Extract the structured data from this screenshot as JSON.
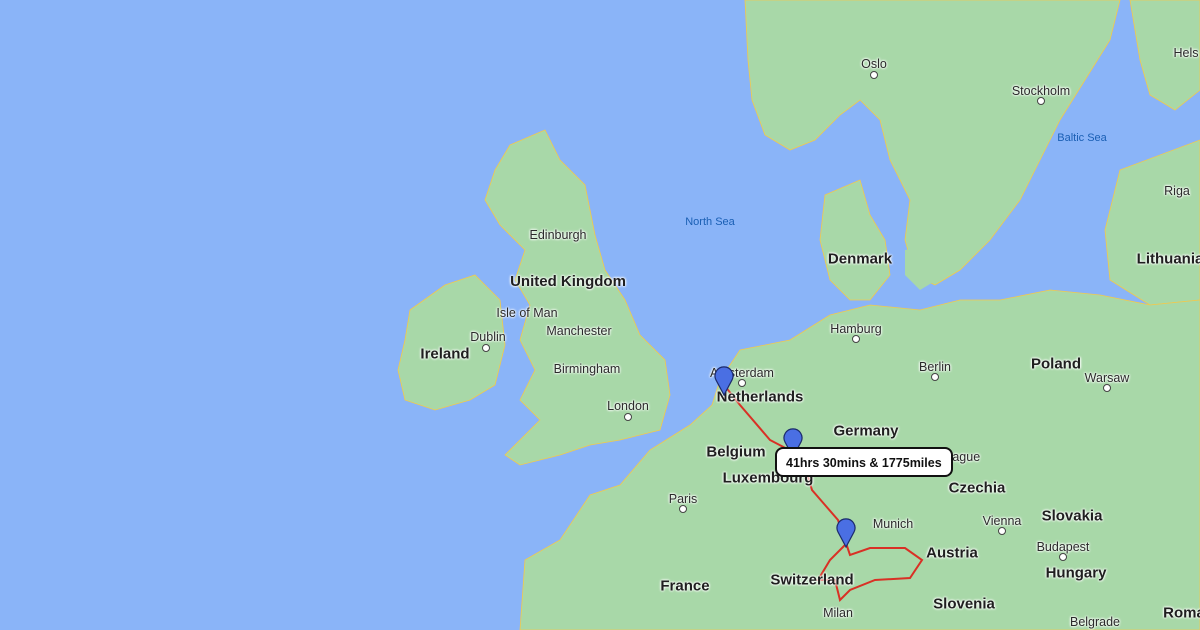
{
  "map": {
    "countries": [
      "United Kingdom",
      "Ireland",
      "Netherlands",
      "Belgium",
      "Luxembourg",
      "France",
      "Germany",
      "Denmark",
      "Poland",
      "Czechia",
      "Slovakia",
      "Austria",
      "Hungary",
      "Switzerland",
      "Slovenia",
      "Lithuania"
    ],
    "cities": [
      "Edinburgh",
      "Isle of Man",
      "Dublin",
      "Manchester",
      "Birmingham",
      "London",
      "Paris",
      "Amsterdam",
      "Hamburg",
      "Berlin",
      "Warsaw",
      "Prague",
      "Vienna",
      "Munich",
      "Milan",
      "Budapest",
      "Oslo",
      "Stockholm",
      "Riga",
      "Belgrade"
    ],
    "partial_labels": [
      "Hels",
      "Roma"
    ],
    "seas": [
      "North Sea",
      "Baltic Sea"
    ]
  },
  "route": {
    "summary": "41hrs 30mins & 1775miles",
    "color": "#d93025",
    "marker_color": "#4a6fe3",
    "markers": [
      "start-marker",
      "waypoint-marker",
      "end-marker"
    ]
  }
}
